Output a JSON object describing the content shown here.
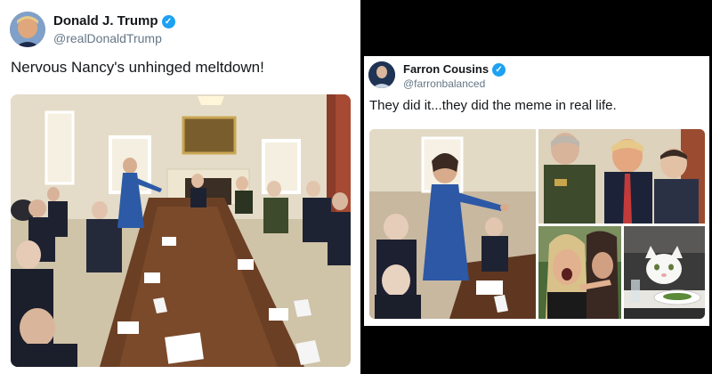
{
  "left_tweet": {
    "display_name": "Donald J. Trump",
    "handle": "@realDonaldTrump",
    "verified_icon": "verified-badge-icon",
    "text": "Nervous Nancy's unhinged meltdown!",
    "media": "photo-cabinet-room-meeting"
  },
  "right_tweet": {
    "display_name": "Farron Cousins",
    "handle": "@farronbalanced",
    "verified_icon": "verified-badge-icon",
    "text": "They did it...they did the meme in real life.",
    "media": [
      "photo-woman-pointing",
      "photo-officials-seated",
      "photo-woman-yelling",
      "photo-cat-at-dinner-table"
    ]
  },
  "colors": {
    "verified_blue": "#1da1f2",
    "name_text": "#14171a",
    "handle_text": "#657786",
    "background": "#000000"
  }
}
